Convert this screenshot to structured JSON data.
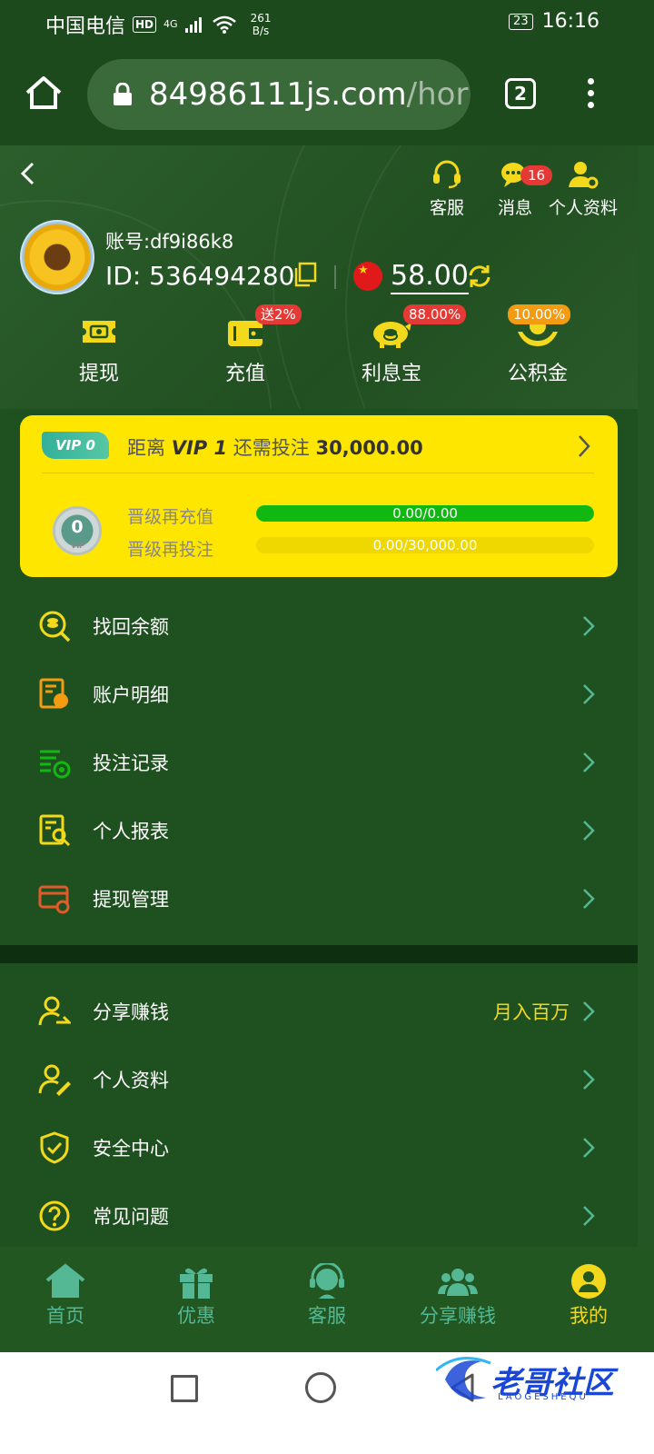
{
  "status_bar": {
    "carrier": "中国电信",
    "hd": "HD",
    "network": "4G",
    "speed_value": "261",
    "speed_unit": "B/s",
    "battery": "23",
    "time": "16:16"
  },
  "browser": {
    "url_main": "84986111js.com",
    "url_rest": "/hor",
    "tab_count": "2"
  },
  "header_actions": [
    {
      "label": "客服",
      "icon": "headset-icon"
    },
    {
      "label": "消息",
      "icon": "chat-icon",
      "badge": "16"
    },
    {
      "label": "个人资料",
      "icon": "user-settings-icon"
    }
  ],
  "account": {
    "account_label": "账号:df9i86k8",
    "id_label": "ID: 536494280",
    "balance": "58.00"
  },
  "quick_actions": [
    {
      "label": "提现",
      "icon": "ticket-icon",
      "badge": ""
    },
    {
      "label": "充值",
      "icon": "wallet-icon",
      "badge": "送2%"
    },
    {
      "label": "利息宝",
      "icon": "piggy-bank-icon",
      "badge": "88.00%"
    },
    {
      "label": "公积金",
      "icon": "hands-coin-icon",
      "badge": "10.00%"
    }
  ],
  "vip": {
    "tag": "VIP 0",
    "prefix": "距离",
    "level": "VIP 1",
    "middle": "还需投注",
    "amount": "30,000.00",
    "medal_level": "0",
    "medal_text": "VIP",
    "recharge_label": "晋级再充值",
    "recharge_value": "0.00/0.00",
    "recharge_progress": 1.0,
    "bet_label": "晋级再投注",
    "bet_value": "0.00/30,000.00",
    "bet_progress": 0.0
  },
  "menu_group_1": [
    {
      "label": "找回余额",
      "icon": "coins-search-icon"
    },
    {
      "label": "账户明细",
      "icon": "account-detail-icon"
    },
    {
      "label": "投注记录",
      "icon": "bet-record-icon"
    },
    {
      "label": "个人报表",
      "icon": "report-icon"
    },
    {
      "label": "提现管理",
      "icon": "card-settings-icon"
    }
  ],
  "menu_group_2": [
    {
      "label": "分享赚钱",
      "icon": "share-user-icon",
      "extra": "月入百万"
    },
    {
      "label": "个人资料",
      "icon": "user-edit-icon",
      "extra": ""
    },
    {
      "label": "安全中心",
      "icon": "shield-check-icon",
      "extra": ""
    },
    {
      "label": "常见问题",
      "icon": "question-icon",
      "extra": ""
    }
  ],
  "bottom_nav": [
    {
      "label": "首页",
      "icon": "home-icon",
      "active": false
    },
    {
      "label": "优惠",
      "icon": "gift-icon",
      "active": false
    },
    {
      "label": "客服",
      "icon": "support-agent-icon",
      "active": false
    },
    {
      "label": "分享赚钱",
      "icon": "group-icon",
      "active": false
    },
    {
      "label": "我的",
      "icon": "profile-icon",
      "active": true
    }
  ],
  "watermark": {
    "text": "老哥社区",
    "sub": "LAOGESHEQU"
  },
  "colors": {
    "bg_green": "#1f5120",
    "accent_yellow": "#f3d81c",
    "vip_yellow": "#ffe600",
    "progress_green": "#12b812",
    "badge_red": "#e53935",
    "nav_teal": "#54b894"
  }
}
